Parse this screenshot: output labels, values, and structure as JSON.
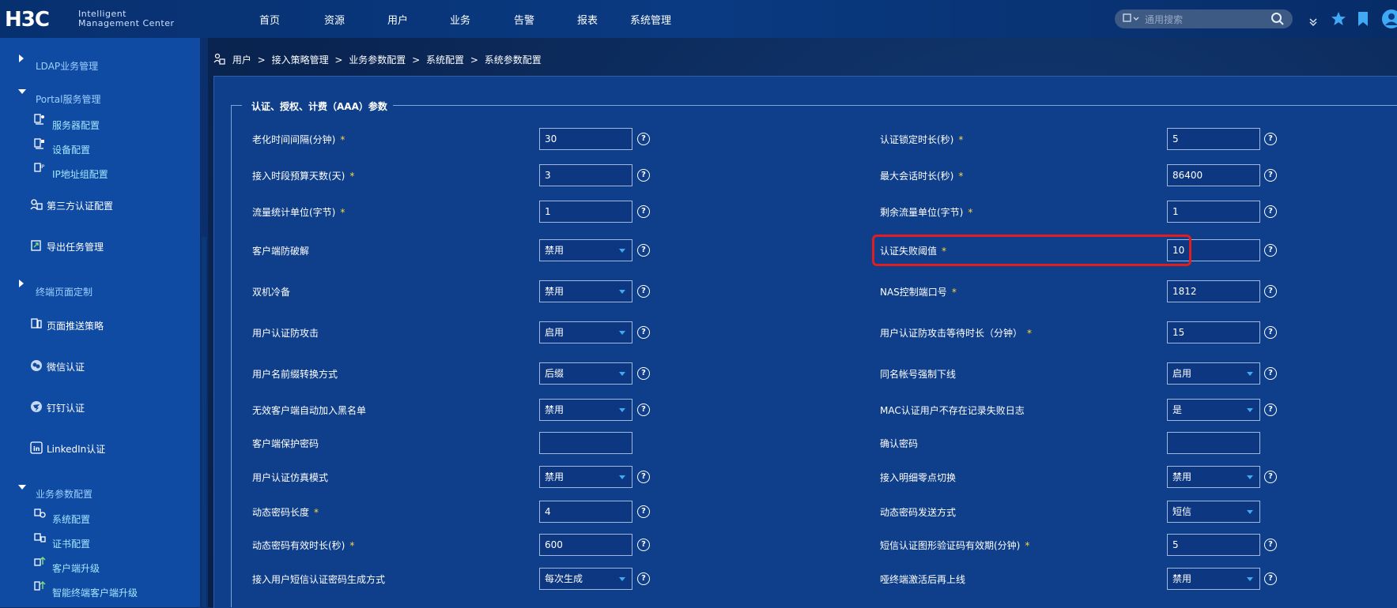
{
  "header": {
    "logo_main": "H3C",
    "logo_line1": "Intelligent",
    "logo_line2": "Management Center",
    "nav": [
      "首页",
      "资源",
      "用户",
      "业务",
      "告警",
      "报表",
      "系统管理"
    ],
    "search_placeholder": "通用搜索"
  },
  "sidebar": {
    "items": [
      {
        "label": "LDAP业务管理",
        "kind": "group"
      },
      {
        "label": "Portal服务管理",
        "kind": "group"
      },
      {
        "label": "服务器配置",
        "kind": "sub"
      },
      {
        "label": "设备配置",
        "kind": "sub"
      },
      {
        "label": "IP地址组配置",
        "kind": "sub"
      },
      {
        "label": "第三方认证配置",
        "kind": "main"
      },
      {
        "label": "导出任务管理",
        "kind": "main"
      },
      {
        "label": "终端页面定制",
        "kind": "group"
      },
      {
        "label": "页面推送策略",
        "kind": "main"
      },
      {
        "label": "微信认证",
        "kind": "main"
      },
      {
        "label": "钉钉认证",
        "kind": "main"
      },
      {
        "label": "LinkedIn认证",
        "kind": "main"
      },
      {
        "label": "业务参数配置",
        "kind": "group"
      },
      {
        "label": "系统配置",
        "kind": "sub"
      },
      {
        "label": "证书配置",
        "kind": "sub"
      },
      {
        "label": "客户端升级",
        "kind": "sub"
      },
      {
        "label": "智能终端客户端升级",
        "kind": "sub"
      }
    ]
  },
  "breadcrumb": {
    "parts": [
      "用户",
      "接入策略管理",
      "业务参数配置",
      "系统配置",
      "系统参数配置"
    ],
    "sep": ">"
  },
  "section": {
    "legend": "认证、授权、计费（AAA）参数"
  },
  "form": {
    "left": [
      {
        "label": "老化时间间隔(分钟)",
        "req": "*",
        "type": "input",
        "value": "30"
      },
      {
        "label": "接入时段预算天数(天)",
        "req": "*",
        "type": "input",
        "value": "3"
      },
      {
        "label": "流量统计单位(字节)",
        "req": "*",
        "type": "input",
        "value": "1"
      },
      {
        "label": "客户端防破解",
        "req": "",
        "type": "select",
        "value": "禁用"
      },
      {
        "label": "双机冷备",
        "req": "",
        "type": "select",
        "value": "禁用"
      },
      {
        "label": "用户认证防攻击",
        "req": "",
        "type": "select",
        "value": "启用"
      },
      {
        "label": "用户名前缀转换方式",
        "req": "",
        "type": "select",
        "value": "后缀"
      },
      {
        "label": "无效客户端自动加入黑名单",
        "req": "",
        "type": "select",
        "value": "禁用"
      },
      {
        "label": "客户端保护密码",
        "req": "",
        "type": "input",
        "value": ""
      },
      {
        "label": "用户认证仿真模式",
        "req": "",
        "type": "select",
        "value": "禁用"
      },
      {
        "label": "动态密码长度",
        "req": "*",
        "type": "input",
        "value": "4"
      },
      {
        "label": "动态密码有效时长(秒)",
        "req": "*",
        "type": "input",
        "value": "600"
      },
      {
        "label": "接入用户短信认证密码生成方式",
        "req": "",
        "type": "select",
        "value": "每次生成"
      }
    ],
    "right": [
      {
        "label": "认证锁定时长(秒)",
        "req": "*",
        "type": "input",
        "value": "5"
      },
      {
        "label": "最大会话时长(秒)",
        "req": "*",
        "type": "input",
        "value": "86400"
      },
      {
        "label": "剩余流量单位(字节)",
        "req": "*",
        "type": "input",
        "value": "1"
      },
      {
        "label": "认证失败阈值",
        "req": "*",
        "type": "input",
        "value": "10"
      },
      {
        "label": "NAS控制端口号",
        "req": "*",
        "type": "input",
        "value": "1812"
      },
      {
        "label": "用户认证防攻击等待时长（分钟）",
        "req": "*",
        "type": "input",
        "value": "15"
      },
      {
        "label": "同名帐号强制下线",
        "req": "",
        "type": "select",
        "value": "启用"
      },
      {
        "label": "MAC认证用户不存在记录失败日志",
        "req": "",
        "type": "select",
        "value": "是"
      },
      {
        "label": "确认密码",
        "req": "",
        "type": "input",
        "value": ""
      },
      {
        "label": "接入明细零点切换",
        "req": "",
        "type": "select",
        "value": "禁用"
      },
      {
        "label": "动态密码发送方式",
        "req": "",
        "type": "select",
        "value": "短信"
      },
      {
        "label": "短信认证图形验证码有效期(分钟)",
        "req": "*",
        "type": "input",
        "value": "5"
      },
      {
        "label": "哑终端激活后再上线",
        "req": "",
        "type": "select",
        "value": "禁用"
      }
    ]
  },
  "help_glyph": "?",
  "colors": {
    "highlight": "#e11d1d",
    "required": "#ffd83a",
    "accent": "#3fa9f5"
  }
}
